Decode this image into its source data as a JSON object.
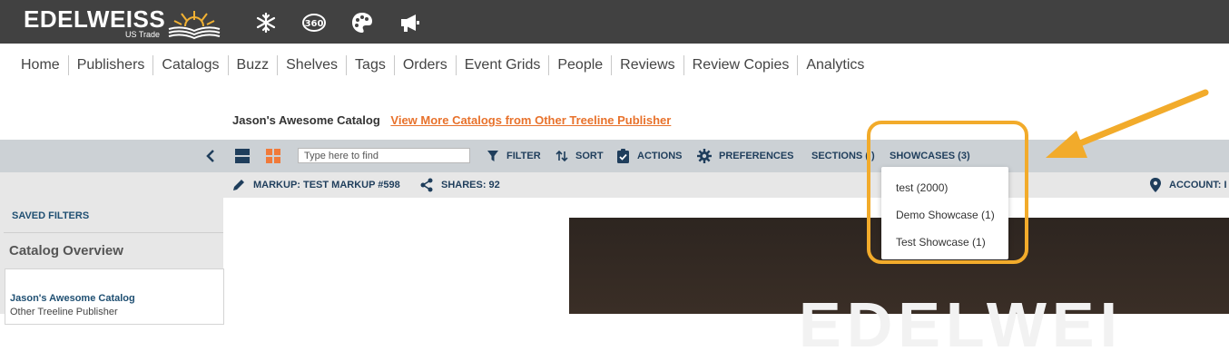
{
  "brand": {
    "name": "EDELWEISS",
    "subtitle": "US Trade",
    "icons": [
      "snowflake-icon",
      "360-icon",
      "palette-icon",
      "megaphone-icon"
    ]
  },
  "nav": {
    "items": [
      "Home",
      "Publishers",
      "Catalogs",
      "Buzz",
      "Shelves",
      "Tags",
      "Orders",
      "Event Grids",
      "People",
      "Reviews",
      "Review Copies",
      "Analytics"
    ]
  },
  "catalog": {
    "title": "Jason's Awesome Catalog",
    "more_link": "View More Catalogs from Other Treeline Publisher"
  },
  "toolbar": {
    "search_placeholder": "Type here to find",
    "filter": "FILTER",
    "sort": "SORT",
    "actions": "ACTIONS",
    "preferences": "PREFERENCES",
    "sections": "SECTIONS ( )",
    "showcases": "SHOWCASES (3)"
  },
  "subbar": {
    "markup": "MARKUP: TEST MARKUP #598",
    "shares": "SHARES: 92",
    "account": "ACCOUNT: I"
  },
  "sidebar": {
    "saved_filters": "SAVED FILTERS",
    "overview": "Catalog Overview",
    "card_title": "Jason's Awesome Catalog",
    "card_sub": "Other Treeline Publisher"
  },
  "showcases_menu": {
    "items": [
      "test (2000)",
      "Demo Showcase (1)",
      "Test Showcase (1)"
    ]
  },
  "preview": {
    "text": "EDELWEI"
  },
  "colors": {
    "topbar": "#414141",
    "toolbar": "#ccd1d5",
    "link": "#e8722c",
    "label": "#1f3e5c",
    "highlight": "#f2ab2b"
  }
}
